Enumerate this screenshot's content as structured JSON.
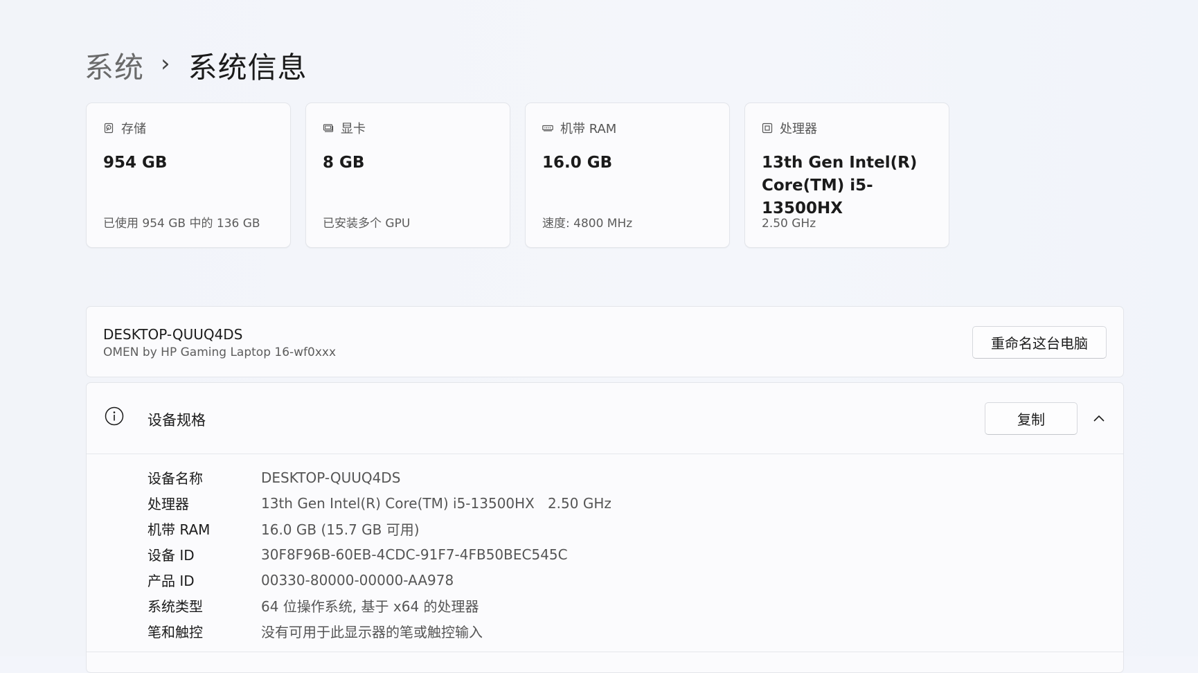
{
  "breadcrumb": {
    "parent": "系统",
    "separator": "›",
    "current": "系统信息"
  },
  "cards": [
    {
      "icon": "storage-icon",
      "title": "存储",
      "value": "954 GB",
      "sub": "已使用 954 GB 中的 136 GB"
    },
    {
      "icon": "gpu-icon",
      "title": "显卡",
      "value": "8 GB",
      "sub": "已安装多个 GPU"
    },
    {
      "icon": "ram-icon",
      "title": "机带 RAM",
      "value": "16.0 GB",
      "sub": "速度: 4800 MHz"
    },
    {
      "icon": "processor-icon",
      "title": "处理器",
      "value_line1": "13th Gen Intel(R)",
      "value_line2": "Core(TM) i5-13500HX",
      "sub": "2.50 GHz"
    }
  ],
  "device": {
    "name": "DESKTOP-QUUQ4DS",
    "model": "OMEN by HP Gaming Laptop 16-wf0xxx",
    "rename_label": "重命名这台电脑"
  },
  "spec": {
    "title": "设备规格",
    "copy_label": "复制",
    "rows": [
      {
        "label": "设备名称",
        "value": "DESKTOP-QUUQ4DS"
      },
      {
        "label": "处理器",
        "value": "13th Gen Intel(R) Core(TM) i5-13500HX   2.50 GHz"
      },
      {
        "label": "机带 RAM",
        "value": "16.0 GB (15.7 GB 可用)"
      },
      {
        "label": "设备 ID",
        "value": "30F8F96B-60EB-4CDC-91F7-4FB50BEC545C"
      },
      {
        "label": "产品 ID",
        "value": "00330-80000-00000-AA978"
      },
      {
        "label": "系统类型",
        "value": "64 位操作系统, 基于 x64 的处理器"
      },
      {
        "label": "笔和触控",
        "value": "没有可用于此显示器的笔或触控输入"
      }
    ]
  },
  "colors": {
    "background": "#f3f5fb",
    "card": "#fbfbfd",
    "border": "#e3e5ea",
    "text_primary": "#1b1b1b",
    "text_secondary": "#5c5c5c"
  }
}
